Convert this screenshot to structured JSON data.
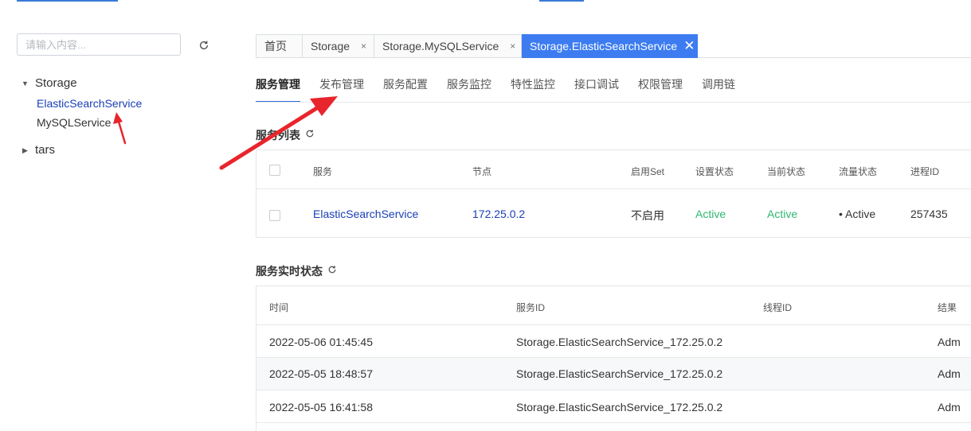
{
  "sidebar": {
    "search_placeholder": "请输入内容...",
    "tree": [
      {
        "label": "Storage",
        "caret": "▼",
        "children": [
          "ElasticSearchService",
          "MySQLService"
        ]
      },
      {
        "label": "tars",
        "caret": "▶"
      }
    ]
  },
  "tabs": [
    {
      "label": "首页"
    },
    {
      "label": "Storage",
      "close": "×"
    },
    {
      "label": "Storage.MySQLService",
      "close": "×"
    },
    {
      "label": "Storage.ElasticSearchService",
      "close": "✕",
      "active": true
    }
  ],
  "subnav": [
    "服务管理",
    "发布管理",
    "服务配置",
    "服务监控",
    "特性监控",
    "接口调试",
    "权限管理",
    "调用链"
  ],
  "service_list": {
    "title": "服务列表",
    "headers": [
      "服务",
      "节点",
      "启用Set",
      "设置状态",
      "当前状态",
      "流量状态",
      "进程ID"
    ],
    "row": {
      "service": "ElasticSearchService",
      "node": "172.25.0.2",
      "set": "不启用",
      "setting_state": "Active",
      "current_state": "Active",
      "traffic_state": "• Active",
      "pid": "257435"
    }
  },
  "realtime": {
    "title": "服务实时状态",
    "headers": [
      "时间",
      "服务ID",
      "线程ID",
      "结果"
    ],
    "rows": [
      {
        "time": "2022-05-06 01:45:45",
        "service_id": "Storage.ElasticSearchService_172.25.0.2",
        "thread_id": "",
        "result": "Adm"
      },
      {
        "time": "2022-05-05 18:48:57",
        "service_id": "Storage.ElasticSearchService_172.25.0.2",
        "thread_id": "",
        "result": "Adm"
      },
      {
        "time": "2022-05-05 16:41:58",
        "service_id": "Storage.ElasticSearchService_172.25.0.2",
        "thread_id": "",
        "result": "Adm"
      }
    ]
  },
  "colors": {
    "accent": "#3c7cf0",
    "link": "#1a3fb5",
    "active_green": "#2eb872",
    "annotation_red": "#e8252c"
  }
}
